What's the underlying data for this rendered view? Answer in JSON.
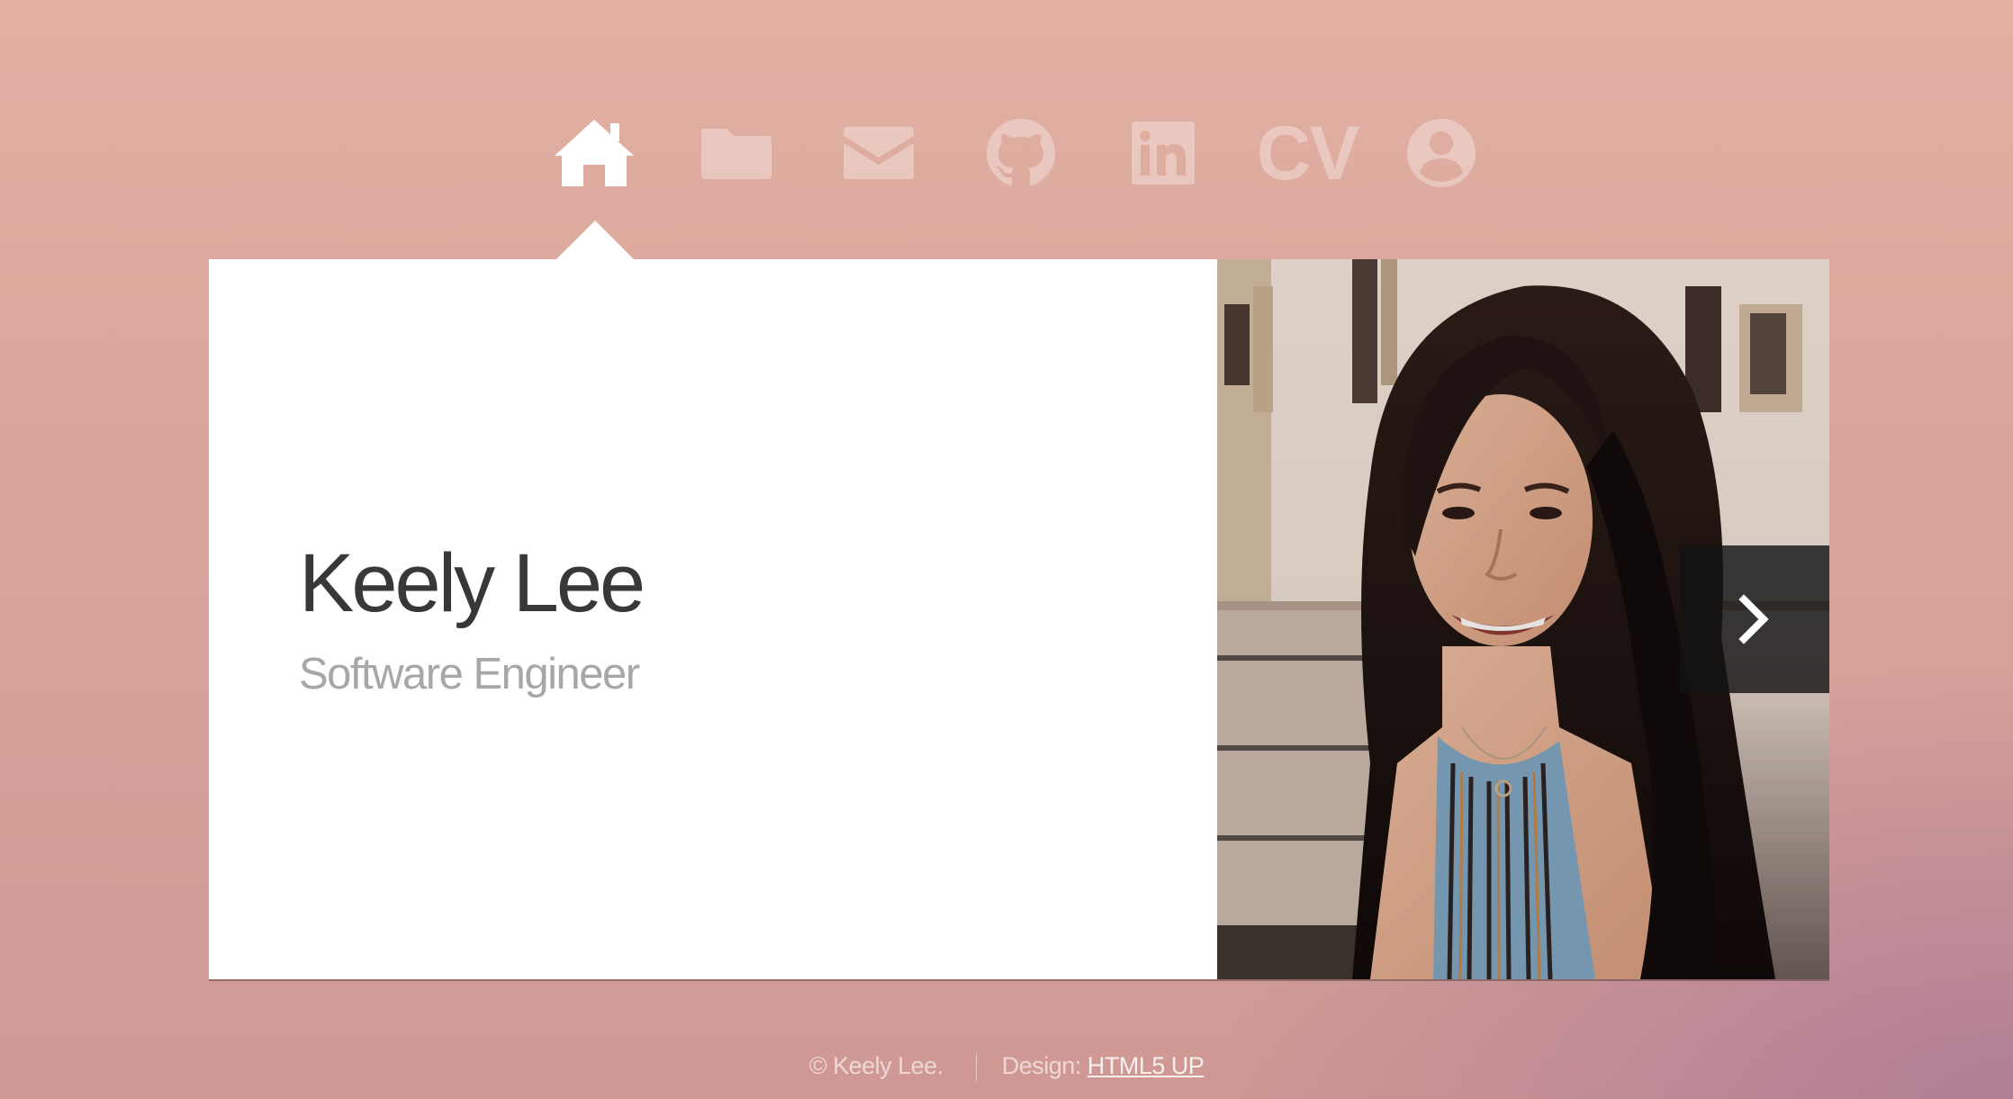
{
  "nav": {
    "items": [
      {
        "icon": "home-icon",
        "active": true
      },
      {
        "icon": "folder-icon",
        "active": false
      },
      {
        "icon": "envelope-icon",
        "active": false
      },
      {
        "icon": "github-icon",
        "active": false
      },
      {
        "icon": "linkedin-icon",
        "active": false
      },
      {
        "label": "CV",
        "active": false
      },
      {
        "icon": "user-icon",
        "active": false
      }
    ]
  },
  "intro": {
    "name": "Keely Lee",
    "role": "Software Engineer"
  },
  "photo": {
    "next_icon": "chevron-right-icon"
  },
  "footer": {
    "copyright": "© Keely Lee.",
    "design_label": "Design:",
    "design_link": "HTML5 UP"
  },
  "colors": {
    "background": "#d9a59b",
    "panel": "#ffffff",
    "name_text": "#37383a",
    "role_text": "#a6a7a9",
    "nav_active": "#ffffff",
    "nav_inactive": "rgba(255,255,255,0.33)"
  }
}
